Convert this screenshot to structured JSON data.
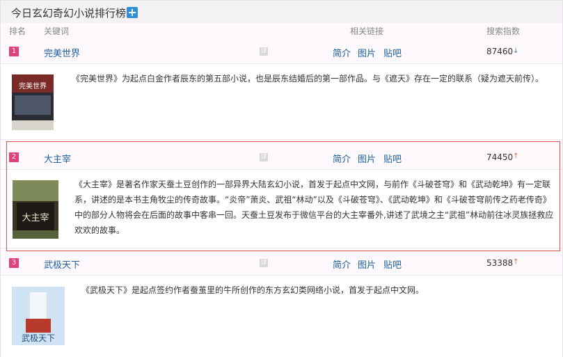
{
  "panel": {
    "title": "今日玄幻奇幻小说排行榜",
    "add_icon": "plus-icon"
  },
  "headers": {
    "rank": "排名",
    "keyword": "关键词",
    "links": "相关链接",
    "index": "搜索指数"
  },
  "rows": [
    {
      "rank": "1",
      "keyword": "完美世界",
      "links": [
        "简介",
        "图片",
        "贴吧"
      ],
      "index": "87460",
      "trend": "down",
      "description": "《完美世界》为起点白金作者辰东的第五部小说，也是辰东结婚后的第一部作品。与《遮天》存在一定的联系（疑为遮天前传）。",
      "cover_text": "完美世界"
    },
    {
      "rank": "2",
      "keyword": "大主宰",
      "links": [
        "简介",
        "图片",
        "贴吧"
      ],
      "index": "74450",
      "trend": "up",
      "description": "《大主宰》是著名作家天蚕土豆创作的一部异界大陆玄幻小说，首发于起点中文网，与前作《斗破苍穹》和《武动乾坤》有一定联系，讲述的是本书主角牧尘的传奇故事。“炎帝”萧炎、武祖“林动”以及《斗破苍穹》、《武动乾坤》和《斗破苍穹前传之药老传奇》中的部分人物将会在后面的故事中客串一回。天蚕土豆发布于微信平台的大主宰番外,讲述了武境之主“武祖”林动前往冰灵族拯救应欢欢的故事。",
      "cover_text": "大主宰"
    },
    {
      "rank": "3",
      "keyword": "武极天下",
      "links": [
        "简介",
        "图片",
        "贴吧"
      ],
      "index": "53388",
      "trend": "up",
      "description": "《武极天下》是起点签约作者蚕茧里的牛所创作的东方玄幻类网络小说，首发于起点中文网。",
      "cover_text": "武极天下"
    }
  ],
  "pin_glyph": "详",
  "arrows": {
    "up": "↑",
    "down": "↓"
  },
  "colors": {
    "rank_badge": "#e2407a",
    "link": "#1f5fa0",
    "up": "#e8673c",
    "down": "#3b82c4",
    "highlight": "#d9534f"
  }
}
